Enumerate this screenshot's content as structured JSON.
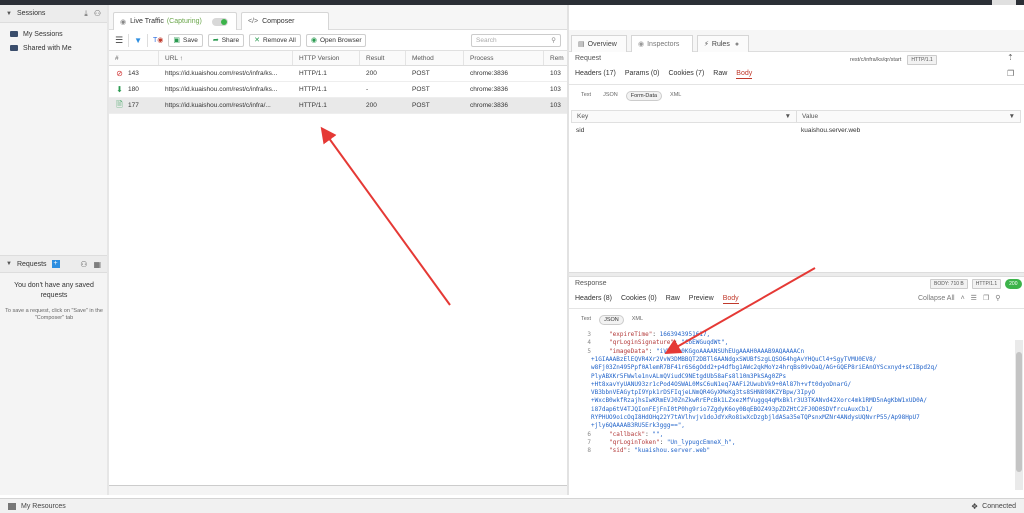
{
  "sidebar": {
    "sessions_label": "Sessions",
    "items": [
      {
        "label": "My Sessions"
      },
      {
        "label": "Shared with Me"
      }
    ],
    "requests_label": "Requests",
    "requests_empty": "You don't have any saved requests",
    "requests_hint": "To save a request, click on \"Save\" in the \"Composer\" tab"
  },
  "tabs": {
    "live_label": "Live Traffic",
    "capturing_label": "(Capturing)",
    "composer_label": "Composer"
  },
  "toolbar": {
    "save_label": "Save",
    "share_label": "Share",
    "remove_all_label": "Remove All",
    "open_browser_label": "Open Browser",
    "search_placeholder": "Search"
  },
  "grid": {
    "headers": [
      "#",
      "URL ↑",
      "HTTP Version",
      "Result",
      "Method",
      "Process",
      "Rem"
    ],
    "rows": [
      {
        "id": "143",
        "url": "https://id.kuaishou.com/rest/c/infra/ks...",
        "version": "HTTP/1.1",
        "result": "200",
        "method": "POST",
        "process": "chrome:3836",
        "rem": "103"
      },
      {
        "id": "180",
        "url": "https://id.kuaishou.com/rest/c/infra/ks...",
        "version": "HTTP/1.1",
        "result": "-",
        "method": "POST",
        "process": "chrome:3836",
        "rem": "103"
      },
      {
        "id": "177",
        "url": "https://id.kuaishou.com/rest/c/infra/...",
        "version": "HTTP/1.1",
        "result": "200",
        "method": "POST",
        "process": "chrome:3836",
        "rem": "103"
      }
    ]
  },
  "inspector": {
    "tabs": [
      "Overview",
      "Inspectors",
      "Rules"
    ],
    "request_label": "Request",
    "request_path": "rest/c/infra/ks/qr/start",
    "request_http": "HTTP/1.1",
    "request_subtabs": [
      "Headers (17)",
      "Params (0)",
      "Cookies (7)",
      "Raw",
      "Body"
    ],
    "body_modes": [
      "Text",
      "JSON",
      "Form-Data",
      "XML"
    ],
    "kv_headers": [
      "Key",
      "Value"
    ],
    "kv_rows": [
      {
        "key": "sid",
        "value": "kuaishou.server.web"
      }
    ],
    "response_label": "Response",
    "response_body_size": "BODY: 710 B",
    "response_http": "HTTP/1.1",
    "response_status": "200",
    "response_subtabs": [
      "Headers (8)",
      "Cookies (0)",
      "Raw",
      "Preview",
      "Body"
    ],
    "collapse_all": "Collapse All",
    "resp_modes": [
      "Text",
      "JSON",
      "XML"
    ]
  },
  "code": {
    "lines": [
      {
        "n": "3",
        "t": "\"expireTime\": 1663943951617,"
      },
      {
        "n": "4",
        "t": "\"qrLoginSignature\": \"CoEWGuqdWt\","
      },
      {
        "n": "5",
        "t": "\"imageData\": \"iVBORw0KGgoAAAANSUhEUgAAAH0AAAB9AQAAAACn"
      },
      {
        "n": "",
        "t": "+1GIAAABzElEQVR4Xr2VvW3DMBBQT2DBTl6AANdgxSWUBfSzgLQSO64hgAvYHQuCl4+SgyTVMU0EV8/"
      },
      {
        "n": "",
        "t": "w8Fj03Zn495Ppf0AlemR7BF41r6S6gOdd2+p4dfbg1AWc2qkMoYz4hrqBs09vOaQ/AG+GQEP8riEAnOYScxnyd+sCIBpd2q/"
      },
      {
        "n": "",
        "t": "PlyABXKr5FWwle1nvALmQViudC9NEtgdUb58aFs8l10m3PkSAg0ZPs"
      },
      {
        "n": "",
        "t": "+Ht8xavYyUANU93zr1cPod4OSWAL0MsC6uN1eq7AAFi2UwubVk9+0Al87h+vft0dyoDnarG/"
      },
      {
        "n": "",
        "t": "VB3bbnVEAGytpI9Ypk1rDSFIqjeLNmQR4GyXMeKg3ts8SHN898KZYBpw/3IpyO"
      },
      {
        "n": "",
        "t": "+WxcB0wkfRzajhsIwKRmEVJ0ZnZkwRrEPcBk1LZxezMfVuggq4qMxBklr3U3TKANvd42Xorc4mk1RMD5nAgKbW1xUD0A/"
      },
      {
        "n": "",
        "t": "i87dap6tV4TJQIonFEjFnI0tP0hg9rio7ZgdyK6oy0BqEBOZ493pZDZHtC2FJ0D0SDVfrcuAuxCb1/"
      },
      {
        "n": "",
        "t": "RYPHUO9oicOqI8HdOHq22Y7tAVlhvjv1doJdYxRo8iwXcDzgbjldASa35eTQPsnxMZNr4ANdysUQNvrP55/Ap98HpU7"
      },
      {
        "n": "",
        "t": "+jly6QAAAAB3RU5Erk3ggg==\","
      },
      {
        "n": "6",
        "t": "\"callback\": \"\","
      },
      {
        "n": "7",
        "t": "\"qrLoginToken\": \"Un_lypugcEmneX_h\","
      },
      {
        "n": "8",
        "t": "\"sid\": \"kuaishou.server.web\""
      }
    ]
  },
  "status": {
    "my_resources": "My Resources",
    "connected": "Connected"
  },
  "colors": {
    "accent_red": "#c0392b",
    "capture_green": "#6aa64a",
    "status_ok": "#3cb34a",
    "json_string": "#1f62c9"
  }
}
